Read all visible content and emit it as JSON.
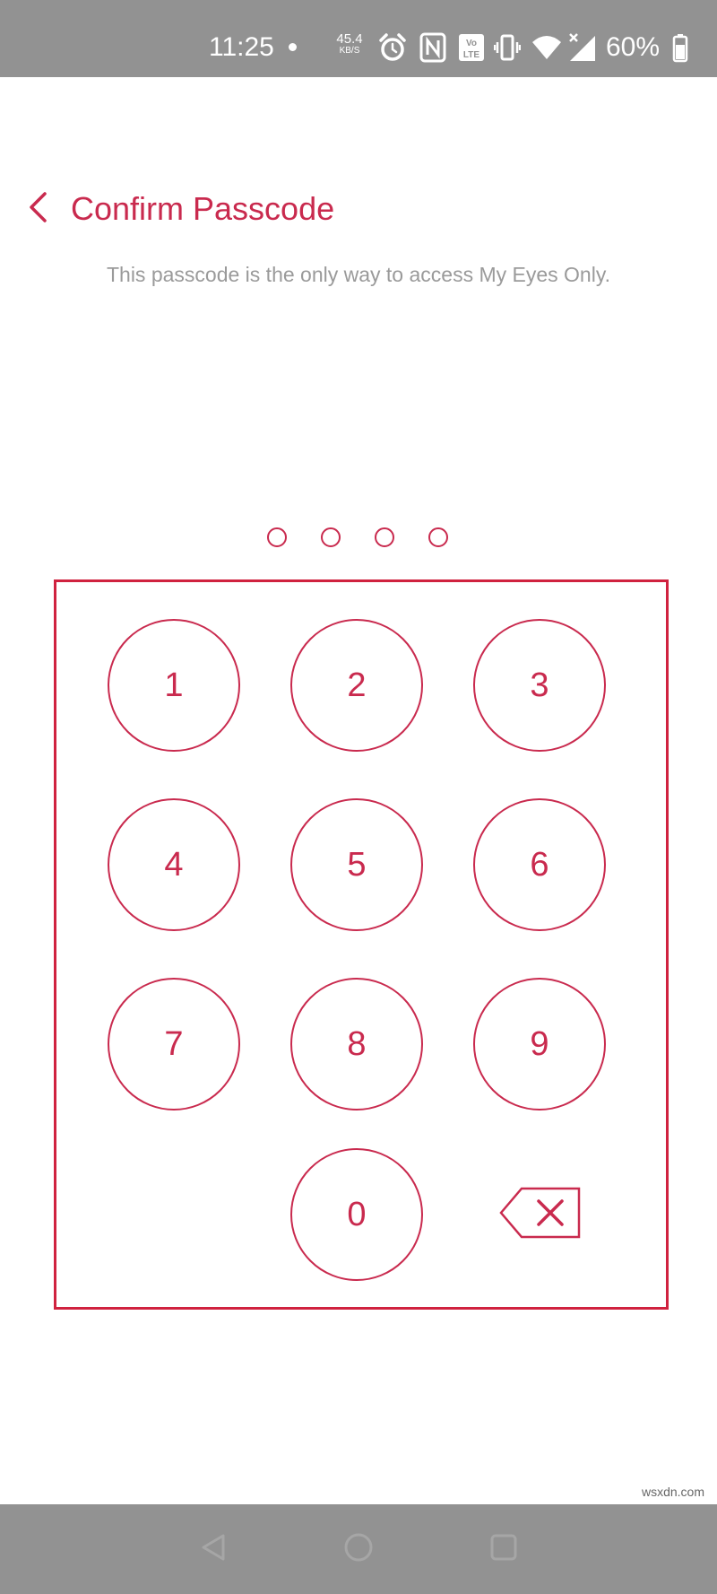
{
  "status_bar": {
    "time": "11:25",
    "net_speed_value": "45.4",
    "net_speed_unit": "KB/S",
    "battery_percent": "60%",
    "icons": [
      "alarm-icon",
      "nfc-icon",
      "volte-icon",
      "vibrate-icon",
      "wifi-icon",
      "signal-icon",
      "battery-icon"
    ]
  },
  "header": {
    "title": "Confirm Passcode",
    "back_icon": "chevron-left-icon"
  },
  "subtitle": "This passcode is the only way to access My Eyes Only.",
  "passcode": {
    "length": 4,
    "entered": 0
  },
  "keypad": {
    "keys": [
      "1",
      "2",
      "3",
      "4",
      "5",
      "6",
      "7",
      "8",
      "9",
      "0"
    ],
    "delete_icon": "backspace-icon"
  },
  "nav_bar": {
    "icons": [
      "back-triangle-icon",
      "home-circle-icon",
      "recents-square-icon"
    ]
  },
  "watermark": "wsxdn.com",
  "colors": {
    "accent": "#c92a4e",
    "frame": "#d0223f",
    "subtitle": "#9a9a9a",
    "system_bar": "#929292"
  }
}
